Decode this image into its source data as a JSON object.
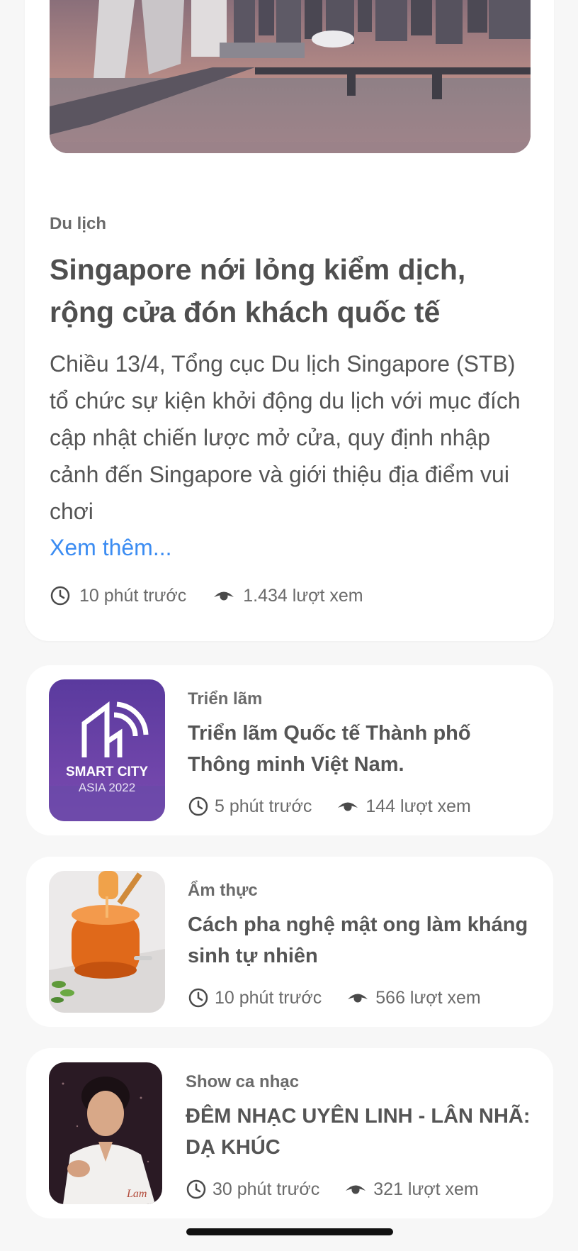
{
  "featured": {
    "category": "Du lịch",
    "title": "Singapore nới lỏng kiểm dịch, rộng cửa đón khách quốc tế",
    "summary": "Chiều 13/4, Tổng cục Du lịch Singapore (STB) tổ chức sự kiện khởi động du lịch với mục đích cập nhật chiến lược mở cửa, quy định nhập cảnh đến Singapore và giới thiệu địa điểm vui chơi",
    "read_more": "Xem thêm...",
    "time": "10 phút trước",
    "views": "1.434 lượt xem",
    "image_icon": "singapore-skyline-photo"
  },
  "articles": [
    {
      "category": "Triển lãm",
      "title": "Triển lãm Quốc tế Thành phố Thông minh Việt Nam.",
      "time": "5 phút trước",
      "views": "144 lượt xem",
      "thumb_line1": "SMART CITY",
      "thumb_line2": "ASIA 2022"
    },
    {
      "category": "Ẩm thực",
      "title": "Cách pha nghệ mật ong làm kháng sinh tự nhiên",
      "time": "10 phút trước",
      "views": "566 lượt xem",
      "image_icon": "honey-jar-photo"
    },
    {
      "category": "Show ca nhạc",
      "title": "ĐÊM NHẠC UYÊN LINH - LÂN NHÃ: DẠ KHÚC",
      "time": "30 phút trước",
      "views": "321 lượt xem",
      "image_icon": "singer-portrait-photo"
    }
  ],
  "colors": {
    "background": "#f7f7f7",
    "card": "#ffffff",
    "link": "#3b8cf2",
    "text": "#4f4f4f",
    "meta": "#6a6a6a"
  }
}
